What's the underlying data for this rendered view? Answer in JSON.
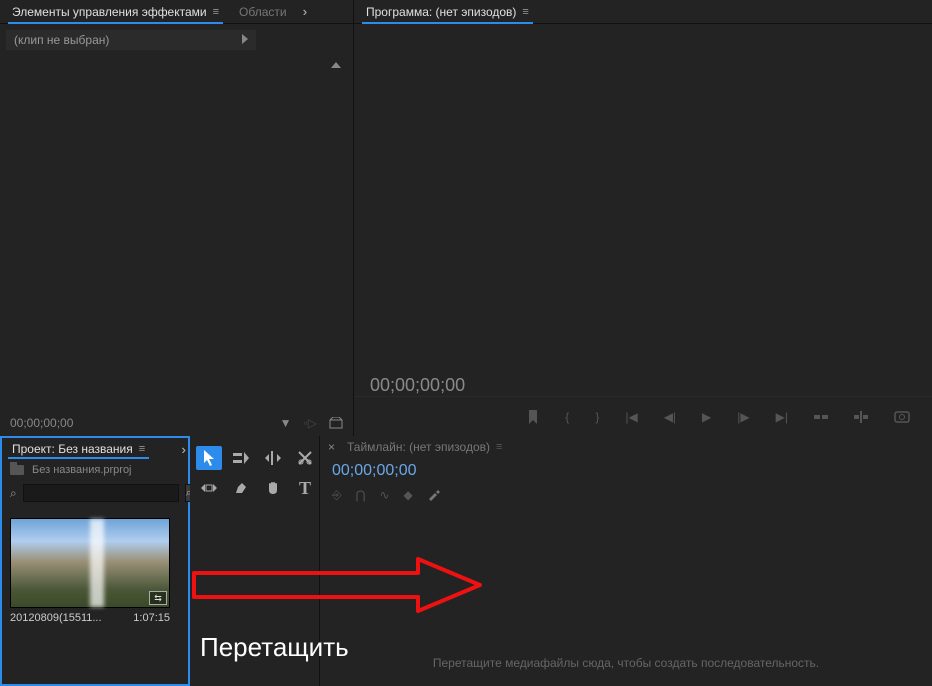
{
  "effects_panel": {
    "tab_active": "Элементы управления эффектами",
    "tab_secondary": "Области",
    "no_clip": "(клип не выбран)",
    "timecode": "00;00;00;00"
  },
  "program_panel": {
    "tab": "Программа: (нет эпизодов)",
    "timecode": "00;00;00;00"
  },
  "project_panel": {
    "tab": "Проект: Без названия",
    "filename": "Без названия.prproj",
    "search_placeholder": " ",
    "search_glyph": "⌕",
    "clip": {
      "name": "20120809(15511...",
      "duration": "1:07:15",
      "badge": "⇆"
    }
  },
  "timeline_panel": {
    "tab": "Таймлайн: (нет эпизодов)",
    "timecode": "00;00;00;00",
    "hint": "Перетащите медиафайлы сюда, чтобы создать последовательность."
  },
  "annotation": {
    "label": "Перетащить"
  }
}
